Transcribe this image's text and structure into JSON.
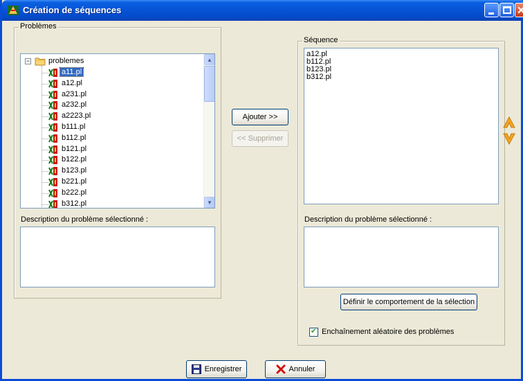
{
  "window": {
    "title": "Création de séquences"
  },
  "left_group": {
    "legend": "Problèmes",
    "tree": {
      "root_label": "problemes",
      "expander": "−",
      "items": [
        "a11.pl",
        "a12.pl",
        "a231.pl",
        "a232.pl",
        "a2223.pl",
        "b111.pl",
        "b112.pl",
        "b121.pl",
        "b122.pl",
        "b123.pl",
        "b221.pl",
        "b222.pl",
        "b312.pl"
      ],
      "selected_index": 0
    },
    "description_label": "Description du problème sélectionné :",
    "description_value": ""
  },
  "middle": {
    "add_label": "Ajouter >>",
    "remove_label": "<< Supprimer"
  },
  "right_group": {
    "legend": "Séquence",
    "items": [
      "a12.pl",
      "b112.pl",
      "b123.pl",
      "b312.pl"
    ],
    "description_label": "Description du problème sélectionné :",
    "description_value": "",
    "define_button_label": "Définir le comportement de la sélection",
    "checkbox_label": "Enchaînement aléatoire des problèmes",
    "checkbox_checked": true,
    "checkmark": "✔"
  },
  "footer": {
    "save_label": "Enregistrer",
    "cancel_label": "Annuler"
  },
  "icons": {
    "app": "app-logo-icon",
    "folder": "folder-icon",
    "file": "problem-file-icon",
    "move_up": "arrow-up-icon",
    "move_down": "arrow-down-icon",
    "save": "floppy-disk-icon",
    "cancel": "red-x-icon"
  },
  "colors": {
    "title_bar": "#0653d6",
    "selection": "#316ac5",
    "arrow_orange": "#f5a623"
  }
}
